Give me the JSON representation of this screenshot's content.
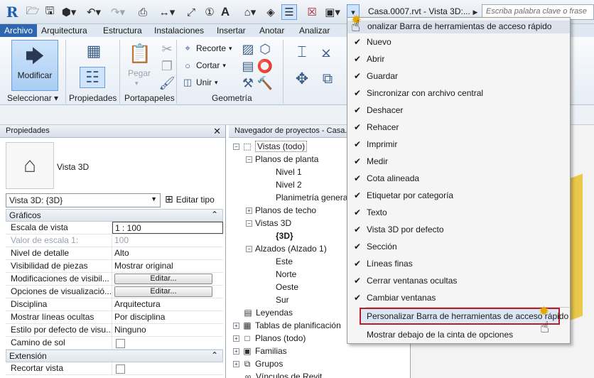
{
  "qat": {
    "logo": "R",
    "title": "Casa.0007.rvt - Vista 3D:...",
    "search_placeholder": "Escriba palabra clave o frase"
  },
  "tabs": [
    "Archivo",
    "Arquitectura",
    "Estructura",
    "Instalaciones",
    "Insertar",
    "Anotar",
    "Analizar"
  ],
  "ribbon": {
    "modificar": "Modificar",
    "pegar": "Pegar",
    "recorte": "Recorte",
    "cortar": "Cortar",
    "unir": "Unir",
    "panels": {
      "seleccionar": "Seleccionar",
      "propiedades": "Propiedades",
      "portapapeles": "Portapapeles",
      "geometria": "Geometría"
    }
  },
  "properties": {
    "title": "Propiedades",
    "type_name": "Vista 3D",
    "type_selector": "Vista 3D: {3D}",
    "edit_type": "Editar tipo",
    "sections": {
      "graficos": "Gráficos",
      "extension": "Extensión"
    },
    "rows": [
      {
        "key": "Escala de vista",
        "value": "1 : 100"
      },
      {
        "key": "Valor de escala    1:",
        "value": "100"
      },
      {
        "key": "Nivel de detalle",
        "value": "Alto"
      },
      {
        "key": "Visibilidad de piezas",
        "value": "Mostrar original"
      },
      {
        "key": "Modificaciones de visibil...",
        "value": "Editar..."
      },
      {
        "key": "Opciones de visualizació...",
        "value": "Editar..."
      },
      {
        "key": "Disciplina",
        "value": "Arquitectura"
      },
      {
        "key": "Mostrar líneas ocultas",
        "value": "Por disciplina"
      },
      {
        "key": "Estilo por defecto de visu...",
        "value": "Ninguno"
      },
      {
        "key": "Camino de sol",
        "value": ""
      }
    ],
    "ext_rows": [
      {
        "key": "Recortar vista",
        "value": ""
      }
    ]
  },
  "browser": {
    "title": "Navegador de proyectos - Casa.",
    "nodes": [
      "Vistas (todo)",
      "Planos de planta",
      "Nivel 1",
      "Nivel 2",
      "Planimetría genera",
      "Planos de techo",
      "Vistas 3D",
      "{3D}",
      "Alzados (Alzado 1)",
      "Este",
      "Norte",
      "Oeste",
      "Sur",
      "Leyendas",
      "Tablas de planificación",
      "Planos (todo)",
      "Familias",
      "Grupos",
      "Vínculos de Revit"
    ]
  },
  "dropdown": {
    "header": "onalizar Barra de herramientas de acceso rápido",
    "items": [
      "Nuevo",
      "Abrir",
      "Guardar",
      "Sincronizar con archivo central",
      "Deshacer",
      "Rehacer",
      "Imprimir",
      "Medir",
      "Cota alineada",
      "Etiquetar por categoría",
      "Texto",
      "Vista 3D por defecto",
      "Sección",
      "Líneas finas",
      "Cerrar ventanas ocultas",
      "Cambiar ventanas"
    ],
    "customize": "Personalizar Barra de herramientas de acceso rápido",
    "show_below": "Mostrar debajo de la cinta de opciones"
  },
  "icons": {
    "open": "open-folder-icon",
    "save": "save-icon",
    "undo": "undo-icon",
    "redo": "redo-icon",
    "print": "print-icon",
    "measure": "measure-icon",
    "text": "text-icon",
    "check": "check-icon"
  },
  "colors": {
    "archivo_tab": "#2f66b0",
    "highlight_border": "#b3202a",
    "selected_button": "#a9cdf4"
  }
}
